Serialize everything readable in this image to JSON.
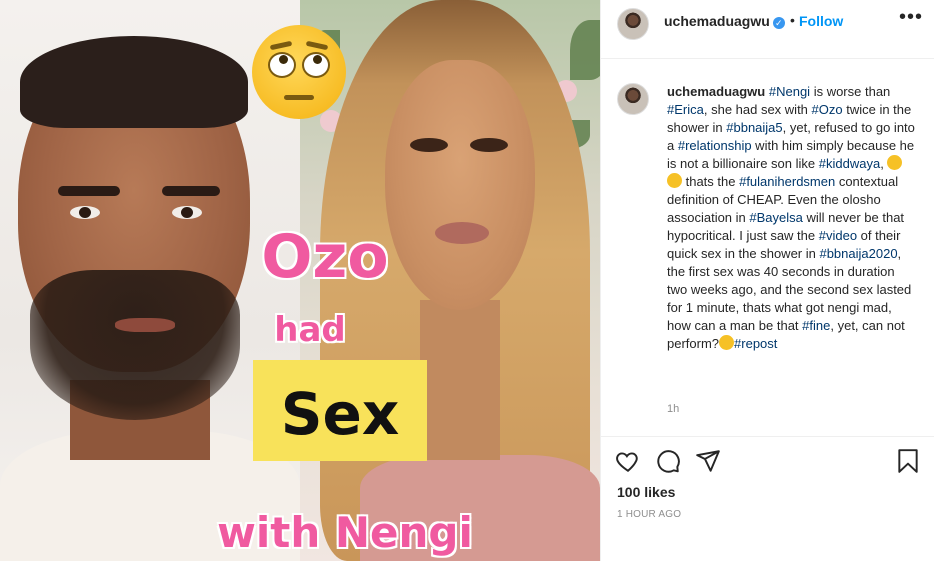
{
  "image_overlay": {
    "line1": "Ozo",
    "line2": "had",
    "line3": "Sex",
    "line4": "with Nengi",
    "emoji": "face-with-rolling-eyes"
  },
  "header": {
    "username": "uchemaduagwu",
    "verified": true,
    "separator": "•",
    "follow_label": "Follow",
    "more_label": "•••"
  },
  "caption": {
    "username": "uchemaduagwu",
    "segments": [
      {
        "t": "#Nengi",
        "tag": true
      },
      {
        "t": " is worse than ",
        "tag": false
      },
      {
        "t": "#Erica",
        "tag": true
      },
      {
        "t": ", she had sex with ",
        "tag": false
      },
      {
        "t": "#Ozo",
        "tag": true
      },
      {
        "t": " twice in the shower in ",
        "tag": false
      },
      {
        "t": "#bbnaija5",
        "tag": true
      },
      {
        "t": ", yet, refused to go into a ",
        "tag": false
      },
      {
        "t": "#relationship",
        "tag": true
      },
      {
        "t": " with him simply because he is not a billionaire son like ",
        "tag": false
      },
      {
        "t": "#kiddwaya",
        "tag": true
      },
      {
        "t": ", ",
        "tag": false
      },
      {
        "t": "[emoji]",
        "emoji": "rofl"
      },
      {
        "t": "[emoji]",
        "emoji": "rofl"
      },
      {
        "t": " thats the ",
        "tag": false
      },
      {
        "t": "#fulaniherdsmen",
        "tag": true
      },
      {
        "t": " contextual definition of CHEAP. Even the olosho association in ",
        "tag": false
      },
      {
        "t": "#Bayelsa",
        "tag": true
      },
      {
        "t": " will never be that hypocritical. I just saw the ",
        "tag": false
      },
      {
        "t": "#video",
        "tag": true
      },
      {
        "t": " of their quick sex in the shower in ",
        "tag": false
      },
      {
        "t": "#bbnaija2020",
        "tag": true
      },
      {
        "t": ", the first sex was 40 seconds in duration two weeks ago, and the second sex lasted for 1 minute, thats what got nengi mad, how can a man be that ",
        "tag": false
      },
      {
        "t": "#fine",
        "tag": true
      },
      {
        "t": ", yet, can not perform?",
        "tag": false
      },
      {
        "t": "[emoji]",
        "emoji": "rofl"
      },
      {
        "t": "#repost",
        "tag": true
      }
    ],
    "time": "1h"
  },
  "actions": {
    "like_icon": "heart-icon",
    "comment_icon": "comment-icon",
    "share_icon": "share-icon",
    "save_icon": "bookmark-icon"
  },
  "likes": "100 likes",
  "posted": "1 HOUR AGO",
  "colors": {
    "link": "#00376b",
    "follow": "#0095f6",
    "overlay_pink": "#f05aa0",
    "overlay_yellow": "#f8e25a"
  }
}
